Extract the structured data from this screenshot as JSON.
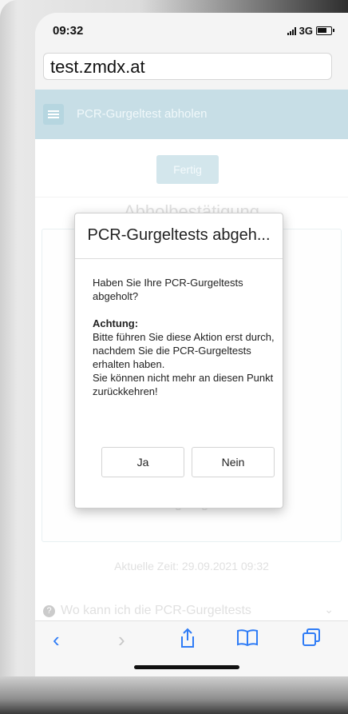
{
  "status_bar": {
    "time": "09:32",
    "network": "3G"
  },
  "browser": {
    "url": "test.zmdx.at"
  },
  "header": {
    "title": "PCR-Gurgeltest abholen"
  },
  "page": {
    "fertig_label": "Fertig",
    "section_title": "Abholbestätigung",
    "gultig": "gültig",
    "current_time": "Aktuelle Zeit: 29.09.2021 09:32",
    "faq_question": "Wo kann ich die PCR-Gurgeltests"
  },
  "dialog": {
    "title": "PCR-Gurgeltests abgeh...",
    "question": "Haben Sie Ihre PCR-Gurgeltests abgeholt?",
    "warning_heading": "Achtung:",
    "warning_line1": "Bitte führen Sie diese Aktion erst durch, nachdem Sie die PCR-Gurgeltests erhalten haben.",
    "warning_line2": "Sie können nicht mehr an diesen Punkt zurückkehren!",
    "yes_label": "Ja",
    "no_label": "Nein"
  },
  "toolbar": {
    "back_icon": "back-chevron-icon",
    "forward_icon": "forward-chevron-icon",
    "share_icon": "share-icon",
    "bookmarks_icon": "bookmarks-icon",
    "tabs_icon": "tabs-icon"
  },
  "colors": {
    "header_bg": "#a9cdd9",
    "accent": "#2f7cf6"
  }
}
